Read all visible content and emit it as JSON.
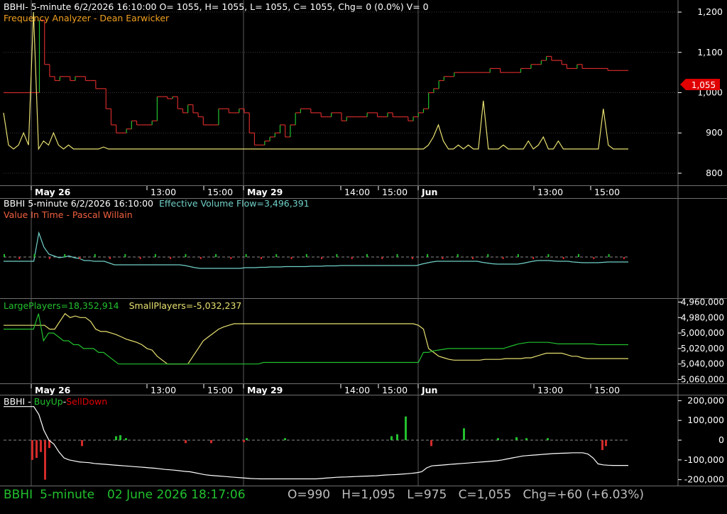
{
  "colors": {
    "bg": "#000000",
    "grid": "#3a3a3a",
    "border": "#707070",
    "white": "#ffffff",
    "green": "#22c02e",
    "red": "#d22a2a",
    "yellow": "#e8e070",
    "orange": "#f0a020",
    "cyan": "#70d0c8",
    "salmon": "#f06040",
    "label_red": "#e00000",
    "status_green": "#22c02e",
    "status_grey": "#bdbdbd"
  },
  "panel1": {
    "header1": "BBHI- 5-minute 6/2/2026 16:10:00 O= 1055, H= 1055, L= 1055, C= 1055, Chg= 0 (0.0%) V= 0",
    "header2": "Frequency Analyzer - Dean Earwicker",
    "price_label": "1,055"
  },
  "panel2": {
    "header_part1": "BBHI 5-minute  6/2/2026 16:10:00",
    "header_part2": "Effective Volume Flow=3,496,391",
    "header2": "Value In Time - Pascal Willain"
  },
  "panel3": {
    "header_large": "LargePlayers=18,352,914",
    "header_small": "SmallPlayers=-5,032,237"
  },
  "panel4": {
    "header_prefix": "BBHI - ",
    "header_buy": "BuyUp",
    "header_sep": "-",
    "header_sell": "SellDown"
  },
  "status": {
    "symbol": "BBHI",
    "interval": "5-minute",
    "datetime": "02 June 2026 18:17:06",
    "ohlc": "O=990   H=1,095   L=975   C=1,055   Chg=+60 (+6.03%)"
  },
  "chart_data": [
    {
      "type": "line",
      "name": "price",
      "x_ticks": [
        "May 26",
        "13:00",
        "15:00",
        "May 29",
        "14:00",
        "15:00",
        "Jun",
        "13:00",
        "15:00"
      ],
      "y_ticks": [
        "1,200",
        "1,100",
        "1,000",
        "900",
        "800"
      ],
      "ylim": [
        770,
        1230
      ],
      "grid": true,
      "series": [
        {
          "values": [
            1000,
            1000,
            1000,
            1000,
            1000,
            1000,
            1000,
            1180,
            1070,
            1040,
            1030,
            1040,
            1040,
            1030,
            1040,
            1040,
            1030,
            1030,
            1010,
            1010,
            960,
            920,
            900,
            900,
            910,
            930,
            920,
            920,
            920,
            930,
            990,
            990,
            985,
            990,
            960,
            950,
            970,
            950,
            940,
            920,
            920,
            920,
            960,
            960,
            950,
            950,
            960,
            950,
            900,
            870,
            870,
            880,
            890,
            900,
            920,
            890,
            920,
            950,
            960,
            960,
            950,
            950,
            940,
            940,
            950,
            950,
            930,
            940,
            940,
            940,
            940,
            950,
            950,
            940,
            940,
            950,
            940,
            940,
            940,
            930,
            940,
            950,
            960,
            1000,
            1010,
            1030,
            1040,
            1040,
            1050,
            1050,
            1050,
            1050,
            1050,
            1050,
            1050,
            1060,
            1060,
            1050,
            1050,
            1050,
            1050,
            1060,
            1060,
            1070,
            1070,
            1080,
            1090,
            1080,
            1080,
            1070,
            1060,
            1060,
            1070,
            1060,
            1060,
            1060,
            1060,
            1060,
            1055,
            1055,
            1055,
            1055,
            1055
          ]
        },
        {
          "name": "Frequency Analyzer",
          "values": [
            950,
            870,
            860,
            870,
            900,
            870,
            1200,
            860,
            880,
            870,
            900,
            870,
            860,
            870,
            860,
            860,
            860,
            860,
            860,
            860,
            865,
            860,
            860,
            860,
            860,
            860,
            860,
            860,
            860,
            860,
            860,
            860,
            860,
            860,
            860,
            860,
            860,
            860,
            860,
            860,
            860,
            860,
            860,
            860,
            860,
            860,
            860,
            860,
            860,
            860,
            860,
            860,
            860,
            860,
            860,
            860,
            860,
            860,
            860,
            860,
            860,
            860,
            860,
            860,
            860,
            860,
            860,
            860,
            860,
            860,
            860,
            860,
            860,
            860,
            860,
            860,
            860,
            860,
            860,
            860,
            860,
            860,
            860,
            860,
            860,
            870,
            890,
            920,
            880,
            860,
            860,
            870,
            860,
            870,
            860,
            860,
            980,
            860,
            860,
            860,
            870,
            860,
            860,
            860,
            860,
            880,
            860,
            870,
            890,
            860,
            860,
            880,
            860,
            860,
            860,
            860,
            860,
            860,
            860,
            860,
            960,
            870,
            860,
            860,
            860,
            860
          ]
        }
      ]
    },
    {
      "type": "line",
      "name": "Effective Volume Flow / Value In Time",
      "series": [
        {
          "name": "Effective Volume Flow",
          "values": [
            0,
            0,
            0,
            0,
            0,
            0,
            0,
            0.8,
            0.4,
            0.2,
            0.15,
            0.1,
            0.12,
            0.15,
            0.1,
            0.08,
            0.02,
            0.02,
            0,
            0,
            0,
            -0.05,
            -0.1,
            -0.1,
            -0.1,
            -0.1,
            -0.1,
            -0.1,
            -0.1,
            -0.1,
            -0.1,
            -0.1,
            -0.1,
            -0.1,
            -0.1,
            -0.1,
            -0.12,
            -0.15,
            -0.18,
            -0.2,
            -0.2,
            -0.2,
            -0.2,
            -0.2,
            -0.2,
            -0.2,
            -0.2,
            -0.2,
            -0.18,
            -0.18,
            -0.18,
            -0.17,
            -0.17,
            -0.16,
            -0.16,
            -0.16,
            -0.15,
            -0.15,
            -0.15,
            -0.15,
            -0.15,
            -0.14,
            -0.14,
            -0.14,
            -0.13,
            -0.13,
            -0.13,
            -0.12,
            -0.12,
            -0.12,
            -0.12,
            -0.12,
            -0.12,
            -0.12,
            -0.12,
            -0.12,
            -0.12,
            -0.12,
            -0.12,
            -0.12,
            -0.12,
            -0.12,
            -0.12,
            -0.08,
            -0.05,
            -0.02,
            0,
            0,
            0,
            0,
            0,
            0,
            0,
            0,
            0,
            -0.03,
            -0.05,
            -0.07,
            -0.08,
            -0.08,
            -0.08,
            -0.08,
            -0.08,
            -0.06,
            -0.03,
            0,
            0.02,
            0.02,
            0.02,
            0.01,
            0,
            0,
            0,
            -0.02,
            -0.03,
            -0.04,
            -0.04,
            -0.04,
            -0.04,
            -0.03,
            -0.02,
            -0.02,
            -0.02,
            -0.02,
            -0.02
          ]
        }
      ]
    },
    {
      "type": "line",
      "name": "LargePlayers / SmallPlayers",
      "y_ticks": [
        "4,960,000",
        "4,980,000",
        "5,000,000",
        "5,020,000",
        "5,040,000",
        "5,060,000"
      ],
      "ylim": [
        4955000,
        5065000
      ]
    },
    {
      "type": "bar",
      "name": "BuyUp-SellDown",
      "y_ticks": [
        "200,000",
        "100,000",
        "0",
        "-100,000",
        "-200,000"
      ],
      "ylim": [
        -230000,
        230000
      ],
      "series": [
        {
          "name": "cumulative",
          "values": [
            170000,
            170000,
            170000,
            170000,
            170000,
            170000,
            170000,
            130000,
            50000,
            0,
            -20000,
            -60000,
            -90000,
            -100000,
            -105000,
            -110000,
            -112000,
            -114000,
            -118000,
            -120000,
            -122000,
            -124000,
            -126000,
            -128000,
            -130000,
            -132000,
            -134000,
            -136000,
            -138000,
            -140000,
            -142000,
            -145000,
            -148000,
            -150000,
            -152000,
            -155000,
            -158000,
            -160000,
            -165000,
            -170000,
            -175000,
            -178000,
            -180000,
            -182000,
            -184000,
            -186000,
            -188000,
            -190000,
            -192000,
            -194000,
            -195000,
            -196000,
            -196000,
            -196000,
            -196000,
            -196000,
            -196000,
            -196000,
            -196000,
            -196000,
            -196000,
            -196000,
            -196000,
            -194000,
            -192000,
            -190000,
            -188000,
            -187000,
            -186000,
            -185000,
            -184000,
            -183000,
            -182000,
            -181000,
            -180000,
            -178000,
            -176000,
            -175000,
            -174000,
            -172000,
            -170000,
            -168000,
            -165000,
            -160000,
            -140000,
            -130000,
            -128000,
            -126000,
            -124000,
            -122000,
            -120000,
            -118000,
            -116000,
            -114000,
            -112000,
            -110000,
            -108000,
            -106000,
            -104000,
            -100000,
            -95000,
            -90000,
            -85000,
            -80000,
            -78000,
            -76000,
            -74000,
            -72000,
            -70000,
            -68000,
            -67000,
            -66000,
            -65000,
            -64000,
            -64000,
            -64000,
            -70000,
            -90000,
            -120000,
            -125000,
            -127000,
            -128000,
            -128000,
            -128000,
            -128000
          ]
        }
      ]
    }
  ]
}
